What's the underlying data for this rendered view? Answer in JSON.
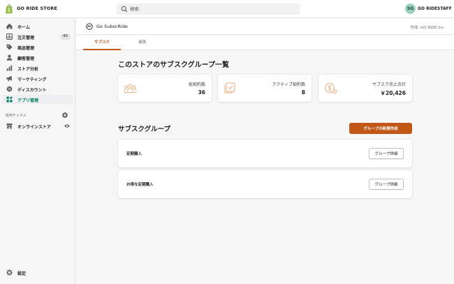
{
  "topbar": {
    "store_name": "GO RIDE STORE",
    "search_placeholder": "検索",
    "user_initials": "SG",
    "user_name": "GO RIDESTAFF"
  },
  "sidebar": {
    "items": [
      {
        "label": "ホーム",
        "icon": "home-icon"
      },
      {
        "label": "注文管理",
        "icon": "orders-icon",
        "badge": "40"
      },
      {
        "label": "商品管理",
        "icon": "tag-icon"
      },
      {
        "label": "顧客管理",
        "icon": "person-icon"
      },
      {
        "label": "ストア分析",
        "icon": "analytics-icon"
      },
      {
        "label": "マーケティング",
        "icon": "megaphone-icon"
      },
      {
        "label": "ディスカウント",
        "icon": "discount-icon"
      },
      {
        "label": "アプリ管理",
        "icon": "apps-icon",
        "active": true
      }
    ],
    "channel_heading": "販売チャネル",
    "channel_item": "オンラインストア",
    "settings_label": "設定"
  },
  "app": {
    "name": "Go SubscRide",
    "author": "作成: GO RIDE,Inc."
  },
  "tabs": [
    {
      "label": "サブスク",
      "active": true
    },
    {
      "label": "顧客",
      "active": false
    }
  ],
  "page": {
    "title": "このストアのサブスクグループ一覧",
    "stats": [
      {
        "label": "総契約数",
        "value": "36",
        "icon": "people-icon"
      },
      {
        "label": "アクティブ契約数",
        "value": "8",
        "icon": "checklist-icon"
      },
      {
        "label": "サブスク売上合計",
        "value": "￥20,426",
        "icon": "dollar-coin-icon"
      }
    ],
    "section_title": "サブスクグループ",
    "create_button": "グループの新規作成",
    "groups": [
      {
        "name": "定期購入",
        "button": "グループ詳細"
      },
      {
        "name": "お得な定期購入",
        "button": "グループ詳細"
      }
    ]
  },
  "colors": {
    "accent": "#c05717",
    "active_nav": "#008060",
    "avatar_bg": "#9bd1c3",
    "stat_icon": "#e8b98e"
  }
}
